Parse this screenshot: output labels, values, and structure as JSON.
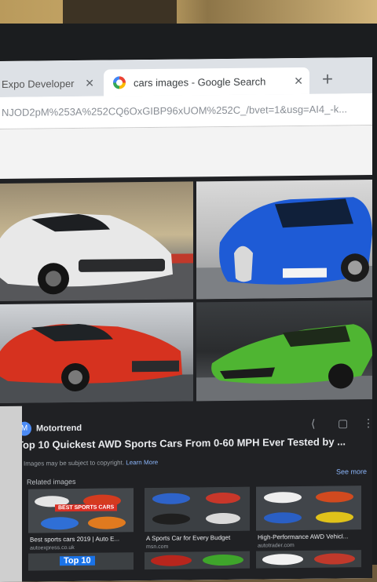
{
  "browser": {
    "tabs": [
      {
        "title": "Expo Developer"
      },
      {
        "title": "cars images - Google Search"
      }
    ],
    "new_tab_symbol": "+",
    "close_symbol": "✕",
    "url": "NJOD2pM%253A%252CQ6OxGIBP96xUOM%252C_/bvet=1&usg=AI4_-k..."
  },
  "result": {
    "source": "Motortrend",
    "source_icon_letter": "M",
    "title": "Top 10 Quickest AWD Sports Cars From 0-60 MPH Ever Tested by ...",
    "copyright": "Images may be subject to copyright.",
    "learn_more": "Learn More",
    "related_label": "Related images",
    "see_more": "See more",
    "related": [
      {
        "caption": "Best sports cars 2019 | Auto E...",
        "source": "autoexpress.co.uk",
        "banner": "BEST SPORTS CARS"
      },
      {
        "caption": "A Sports Car for Every Budget",
        "source": "msn.com"
      },
      {
        "caption": "High-Performance AWD Vehicl...",
        "source": "autotrader.com"
      }
    ],
    "top10_banner": "Top 10"
  },
  "icons": {
    "share": "⟨",
    "save": "▢",
    "more": "⋮"
  },
  "colors": {
    "panel_bg": "#202124",
    "link": "#8ab4f8",
    "tab_bar": "#dde1e6"
  }
}
